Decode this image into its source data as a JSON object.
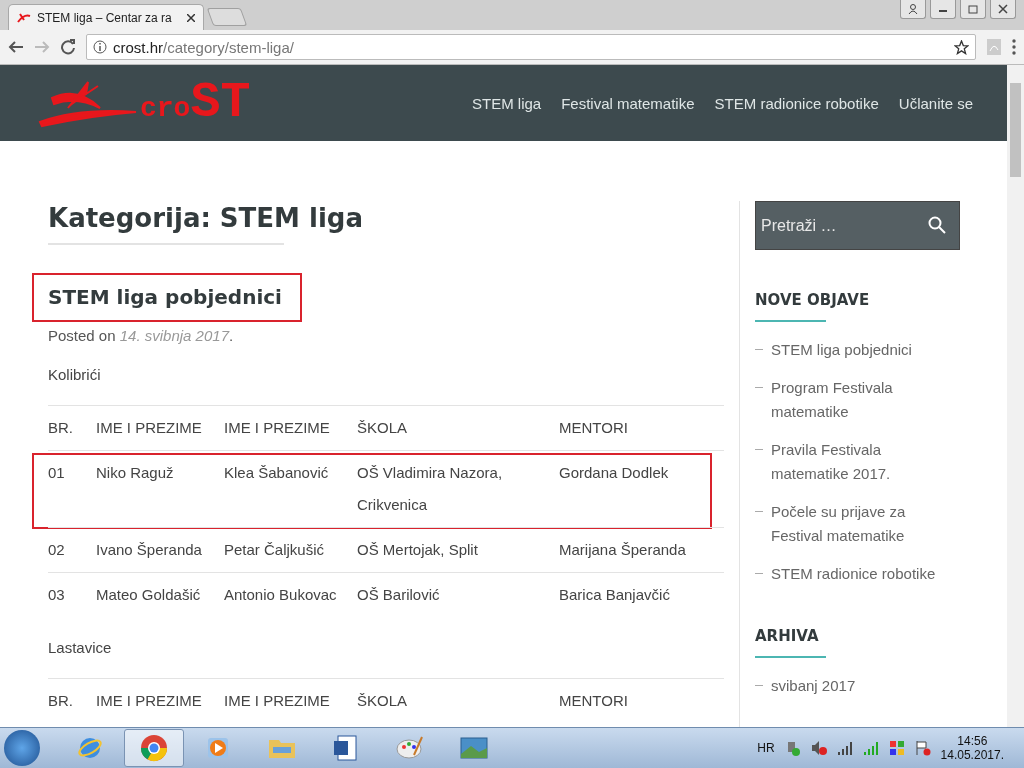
{
  "browser": {
    "tabs": [
      {
        "title": "STEM liga – Centar za ra",
        "selected": true
      }
    ],
    "address": {
      "host": "crost.hr",
      "path": "/category/stem-liga/"
    }
  },
  "site": {
    "logo": {
      "part_1": "cro",
      "part_2": "ST"
    },
    "nav": [
      "STEM liga",
      "Festival matematike",
      "STEM radionice robotike",
      "Učlanite se"
    ]
  },
  "page_title": "Kategorija: STEM liga",
  "post": {
    "title": "STEM liga pobjednici",
    "highlighted": true,
    "posted_label": "Posted on",
    "date": "14. svibnja 2017",
    "date_suffix": ".",
    "sections": [
      {
        "heading": "Kolibrići",
        "columns": [
          "BR.",
          "IME I PREZIME",
          "IME I PREZIME",
          "ŠKOLA",
          "MENTORI"
        ],
        "rows": [
          {
            "cells": [
              "01",
              "Niko Raguž",
              "Klea Šabanović",
              "OŠ Vladimira Nazora, Crikvenica",
              "Gordana Dodlek"
            ],
            "highlighted": true
          },
          {
            "cells": [
              "02",
              "Ivano Šperanda",
              "Petar Čaljkušić",
              "OŠ Mertojak, Split",
              "Marijana Šperanda"
            ],
            "highlighted": false
          },
          {
            "cells": [
              "03",
              "Mateo Goldašić",
              "Antonio Bukovac",
              "OŠ Barilović",
              "Barica Banjavčić"
            ],
            "highlighted": false
          }
        ]
      },
      {
        "heading": "Lastavice",
        "columns": [
          "BR.",
          "IME I PREZIME",
          "IME I PREZIME",
          "ŠKOLA",
          "MENTORI"
        ]
      }
    ]
  },
  "sidebar": {
    "search": {
      "placeholder": "Pretraži …"
    },
    "widgets": [
      {
        "title": "NOVE OBJAVE",
        "items": [
          "STEM liga pobjednici",
          "Program Festivala matematike",
          "Pravila Festivala matematike 2017.",
          "Počele su prijave za Festival matematike",
          "STEM radionice robotike"
        ]
      },
      {
        "title": "ARHIVA",
        "items": [
          "svibanj 2017"
        ]
      }
    ]
  },
  "taskbar": {
    "apps": [
      {
        "kind": "ie",
        "selected": false
      },
      {
        "kind": "chrome",
        "selected": true
      },
      {
        "kind": "media",
        "selected": false
      },
      {
        "kind": "folder",
        "selected": false
      },
      {
        "kind": "word",
        "selected": false
      },
      {
        "kind": "paint",
        "selected": false
      },
      {
        "kind": "photo",
        "selected": false
      }
    ],
    "language": "HR",
    "time": "14:56",
    "date": "14.05.2017."
  }
}
